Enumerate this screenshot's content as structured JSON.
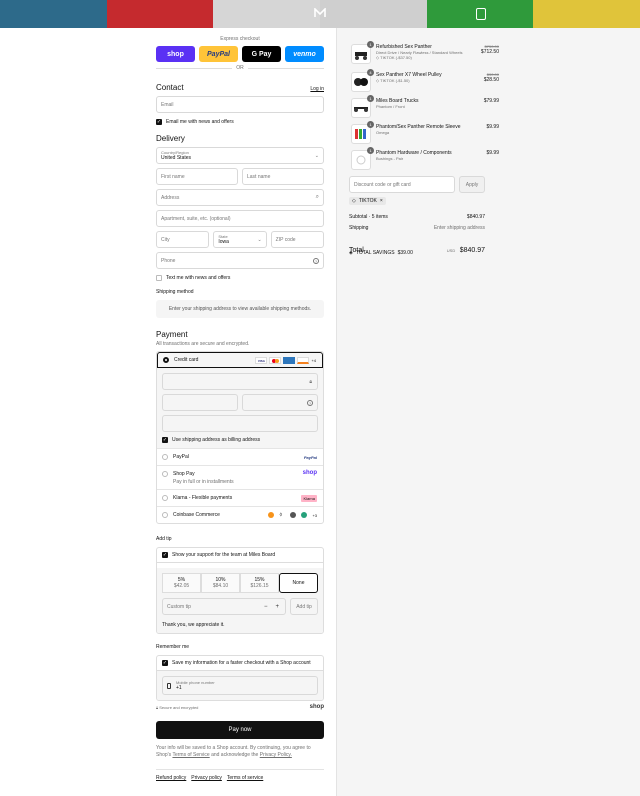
{
  "banner_colors": [
    "#2d6a8a",
    "#c52a2e",
    "#d6d6d6",
    "#cfcfcf",
    "#2f9a3b",
    "#e0c43a"
  ],
  "express": {
    "label": "Express checkout",
    "or": "OR",
    "shop": "shop",
    "paypal": "PayPal",
    "gpay": "G Pay",
    "venmo": "venmo"
  },
  "contact": {
    "title": "Contact",
    "login": "Log in",
    "email_placeholder": "Email",
    "news": "Email me with news and offers"
  },
  "delivery": {
    "title": "Delivery",
    "country_label": "Country/Region",
    "country_value": "United States",
    "first_name": "First name",
    "last_name": "Last name",
    "address": "Address",
    "apartment": "Apartment, suite, etc. (optional)",
    "city": "City",
    "state_label": "State",
    "state_value": "Iowa",
    "zip": "ZIP code",
    "phone": "Phone",
    "text_me": "Text me with news and offers"
  },
  "shipping": {
    "title": "Shipping method",
    "info": "Enter your shipping address to view available shipping methods."
  },
  "payment": {
    "title": "Payment",
    "subtitle": "All transactions are secure and encrypted.",
    "credit_card": "Credit card",
    "more_cards": "+4",
    "billing": "Use shipping address as billing address",
    "paypal": "PayPal",
    "paypal_logo": "PayPal",
    "shoppay": "Shop Pay",
    "shoppay_sub": "Pay in full or in installments",
    "shoppay_logo": "shop",
    "klarna": "Klarna - Flexible payments",
    "klarna_logo": "Klarna",
    "coinbase": "Coinbase Commerce",
    "coinbase_more": "+3"
  },
  "tip": {
    "title": "Add tip",
    "support": "Show your support for the team at Miles Board",
    "options": [
      {
        "pct": "5%",
        "amt": "$42.05"
      },
      {
        "pct": "10%",
        "amt": "$84.10"
      },
      {
        "pct": "15%",
        "amt": "$126.15"
      },
      {
        "pct": "None",
        "amt": ""
      }
    ],
    "custom": "Custom tip",
    "add": "Add tip",
    "thanks": "Thank you, we appreciate it."
  },
  "remember": {
    "title": "Remember me",
    "save": "Save my information for a faster checkout with a Shop account",
    "phone_label": "Mobile phone number",
    "phone_value": "+1",
    "secure": "Secure and encrypted",
    "shop": "shop"
  },
  "pay_now": "Pay now",
  "legal": {
    "text": "Your info will be saved to a Shop account. By continuing, you agree to Shop's",
    "terms": "Terms of Service",
    "and": "and acknowledge the",
    "privacy": "Privacy Policy."
  },
  "footer": {
    "refund": "Refund policy",
    "privacy": "Privacy policy",
    "terms": "Terms of service"
  },
  "cart": {
    "items": [
      {
        "qty": "1",
        "name": "Refurbished Sex Panther",
        "sub": "Direct Drive / Nearly Flawless / Standard Wheels",
        "discount": "TIKTOK (-$37.50)",
        "old_price": "$750.00",
        "price": "$712.50"
      },
      {
        "qty": "4",
        "name": "Sex Panther X7 Wheel Pulley",
        "sub": "",
        "discount": "TIKTOK (-$1.50)",
        "old_price": "$30.00",
        "price": "$28.50"
      },
      {
        "qty": "1",
        "name": "Miles Board Trucks",
        "sub": "Phantom / Front",
        "discount": "",
        "old_price": "",
        "price": "$79.99"
      },
      {
        "qty": "1",
        "name": "Phantom/Sex Panther Remote Sleeve",
        "sub": "Omega",
        "discount": "",
        "old_price": "",
        "price": "$9.99"
      },
      {
        "qty": "1",
        "name": "Phantom Hardware / Components",
        "sub": "Bushings - Pair",
        "discount": "",
        "old_price": "",
        "price": "$9.99"
      }
    ],
    "discount_placeholder": "Discount code or gift card",
    "apply": "Apply",
    "code_tag": "TIKTOK",
    "subtotal_label": "Subtotal · 5 items",
    "subtotal": "$840.97",
    "shipping_label": "Shipping",
    "shipping_value": "Enter shipping address",
    "total_label": "Total",
    "currency": "USD",
    "total": "$840.97",
    "savings_label": "TOTAL SAVINGS",
    "savings": "$39.00"
  }
}
